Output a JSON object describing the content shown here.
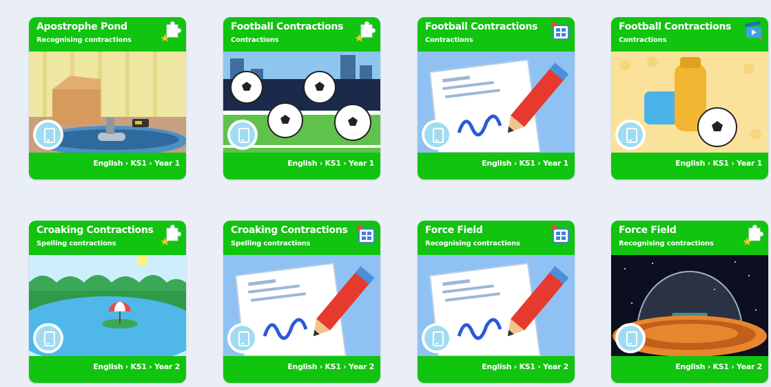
{
  "cards": [
    {
      "title": "Apostrophe Pond",
      "subtitle": "Recognising contractions",
      "path": "English › KS1 › Year 1",
      "type_icon": "puzzle-icon",
      "image": "pond-scene",
      "device_icon": "tablet-icon"
    },
    {
      "title": "Football Contractions",
      "subtitle": "Contractions",
      "path": "English › KS1 › Year 1",
      "type_icon": "puzzle-icon",
      "image": "footballs-scene",
      "device_icon": "tablet-icon"
    },
    {
      "title": "Football Contractions",
      "subtitle": "Contractions",
      "path": "English › KS1 › Year 1",
      "type_icon": "worksheet-icon",
      "image": "worksheet-scene",
      "device_icon": "tablet-icon"
    },
    {
      "title": "Football Contractions",
      "subtitle": "Contractions",
      "path": "English › KS1 › Year 1",
      "type_icon": "video-icon",
      "image": "kit-scene",
      "device_icon": "tablet-icon"
    },
    {
      "title": "Croaking Contractions",
      "subtitle": "Spelling contractions",
      "path": "English › KS1 › Year 2",
      "type_icon": "puzzle-icon",
      "image": "lake-scene",
      "device_icon": "tablet-icon"
    },
    {
      "title": "Croaking Contractions",
      "subtitle": "Spelling contractions",
      "path": "English › KS1 › Year 2",
      "type_icon": "worksheet-icon",
      "image": "worksheet-scene",
      "device_icon": "tablet-icon"
    },
    {
      "title": "Force Field",
      "subtitle": "Recognising contractions",
      "path": "English › KS1 › Year 2",
      "type_icon": "worksheet-icon",
      "image": "worksheet-scene",
      "device_icon": "tablet-icon"
    },
    {
      "title": "Force Field",
      "subtitle": "Recognising contractions",
      "path": "English › KS1 › Year 2",
      "type_icon": "puzzle-icon",
      "image": "space-dome-scene",
      "device_icon": "tablet-icon"
    }
  ]
}
